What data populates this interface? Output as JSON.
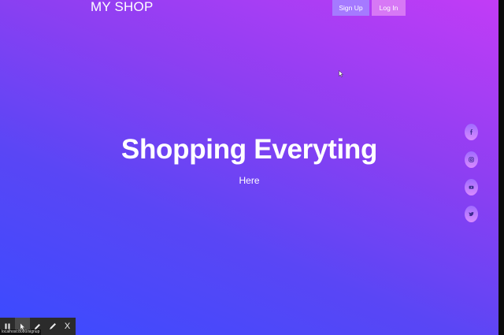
{
  "header": {
    "brand": "MY SHOP",
    "signup_label": "Sign Up",
    "login_label": "Log In"
  },
  "hero": {
    "title": "Shopping Everyting",
    "subtitle": "Here"
  },
  "social": [
    {
      "icon": "facebook-icon"
    },
    {
      "icon": "instagram-icon"
    },
    {
      "icon": "youtube-icon"
    },
    {
      "icon": "twitter-icon"
    }
  ],
  "recorder_toolbar": {
    "close_label": "X",
    "url_tooltip": "localhost:8080/signup"
  },
  "colors": {
    "gradient_start": "#3a4bff",
    "gradient_end": "#c23cf6",
    "signup_bg": "#a57aff",
    "login_bg": "#d778f5"
  }
}
